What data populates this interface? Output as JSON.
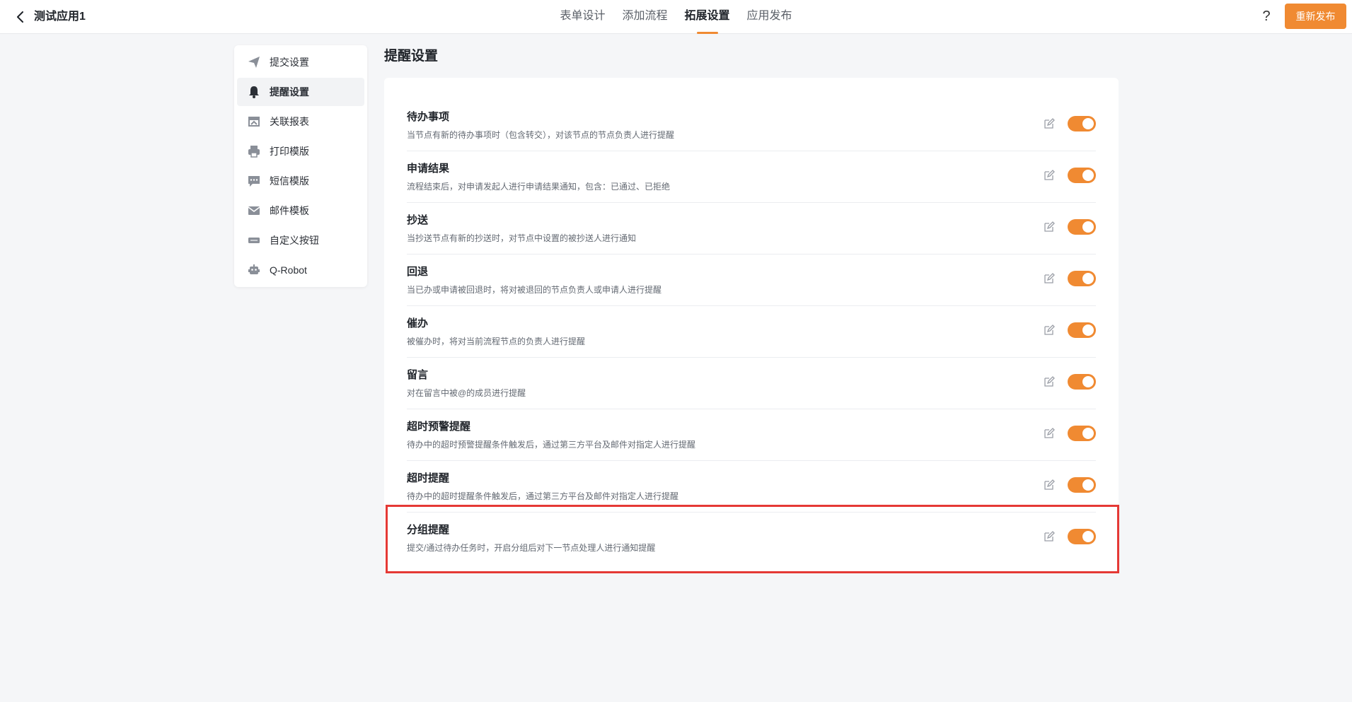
{
  "header": {
    "app_title": "测试应用1",
    "tabs": [
      {
        "label": "表单设计"
      },
      {
        "label": "添加流程"
      },
      {
        "label": "拓展设置"
      },
      {
        "label": "应用发布"
      }
    ],
    "active_tab": "拓展设置",
    "help_label": "?",
    "publish_label": "重新发布"
  },
  "sidebar": {
    "items": [
      {
        "label": "提交设置",
        "icon": "send-icon"
      },
      {
        "label": "提醒设置",
        "icon": "bell-icon"
      },
      {
        "label": "关联报表",
        "icon": "report-icon"
      },
      {
        "label": "打印模版",
        "icon": "printer-icon"
      },
      {
        "label": "短信模版",
        "icon": "sms-icon"
      },
      {
        "label": "邮件模板",
        "icon": "mail-icon"
      },
      {
        "label": "自定义按钮",
        "icon": "button-icon"
      },
      {
        "label": "Q-Robot",
        "icon": "robot-icon"
      }
    ],
    "active_item": "提醒设置"
  },
  "main": {
    "title": "提醒设置",
    "rows": [
      {
        "title": "待办事项",
        "desc": "当节点有新的待办事项时（包含转交），对该节点的节点负责人进行提醒",
        "enabled": true
      },
      {
        "title": "申请结果",
        "desc": "流程结束后，对申请发起人进行申请结果通知，包含：已通过、已拒绝",
        "enabled": true
      },
      {
        "title": "抄送",
        "desc": "当抄送节点有新的抄送时，对节点中设置的被抄送人进行通知",
        "enabled": true
      },
      {
        "title": "回退",
        "desc": "当已办或申请被回退时，将对被退回的节点负责人或申请人进行提醒",
        "enabled": true
      },
      {
        "title": "催办",
        "desc": "被催办时，将对当前流程节点的负责人进行提醒",
        "enabled": true
      },
      {
        "title": "留言",
        "desc": "对在留言中被@的成员进行提醒",
        "enabled": true
      },
      {
        "title": "超时预警提醒",
        "desc": "待办中的超时预警提醒条件触发后，通过第三方平台及邮件对指定人进行提醒",
        "enabled": true
      },
      {
        "title": "超时提醒",
        "desc": "待办中的超时提醒条件触发后，通过第三方平台及邮件对指定人进行提醒",
        "enabled": true
      },
      {
        "title": "分组提醒",
        "desc": "提交/通过待办任务时，开启分组后对下一节点处理人进行通知提醒",
        "enabled": true
      }
    ]
  },
  "colors": {
    "accent": "#f08a32",
    "highlight_border": "#e53935",
    "background": "#f5f6f8"
  }
}
